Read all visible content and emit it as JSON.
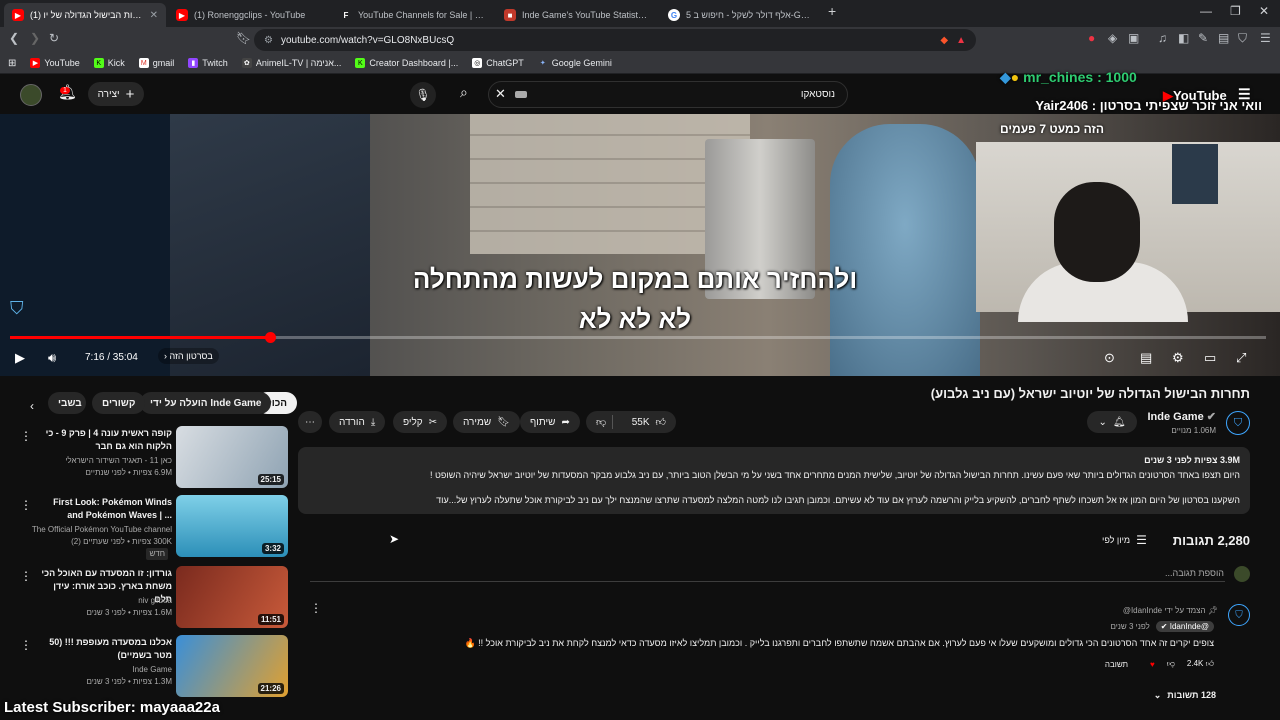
{
  "browser": {
    "tabs": [
      {
        "label": "(1) תחרות הבישול הגדולה של יו",
        "favicon": "youtube-icon",
        "active": true
      },
      {
        "label": "(1) Ronenggclips - YouTube",
        "favicon": "youtube-icon",
        "active": false
      },
      {
        "label": "YouTube Channels for Sale | Flippa",
        "favicon": "flippa-icon",
        "active": false
      },
      {
        "label": "Inde Game's YouTube Statistics - Soc",
        "favicon": "socialblade-icon",
        "active": false
      },
      {
        "label": "5 אלף דולר לשקל - חיפוש ב-Google",
        "favicon": "google-icon",
        "active": false
      }
    ],
    "url": "youtube.com/watch?v=GLO8NxBUcsQ",
    "bookmarks": [
      "YouTube",
      "Kick",
      "gmail",
      "Twitch",
      "AnimeIL-TV | אנימה...",
      "Creator Dashboard |...",
      "ChatGPT",
      "Google Gemini"
    ]
  },
  "header": {
    "create_label": "יצירה",
    "notif_count": "1",
    "search_value": "נוסטאקו"
  },
  "video": {
    "subtitle_line1": "ולהחזיר אותם במקום לעשות מהתחלה",
    "subtitle_line2": "לא לא לא",
    "time": "7:16 / 35:04",
    "chapter": "בסרטון הזה",
    "progress_fraction": 0.207,
    "overlay_top": "mr_chines : 1000",
    "overlay_yt": "YouTube",
    "overlay_line2": "וואי אני זוכר שצפיתי בסרטון : Yair2406",
    "overlay_line3": "הזה כמעט 7 פעמים",
    "overlay_bottom": "Latest Subscriber: mayaaa22a"
  },
  "info": {
    "title": "תחרות הבישול הגדולה של יוטיוב ישראל (עם ניב גלבוע)",
    "channel": "Inde Game",
    "subscribers": "1.06M מנויים",
    "likes": "55K",
    "share": "שיתוף",
    "save": "שמירה",
    "clip": "קליפ",
    "download": "הורדה",
    "desc_meta": "3.9M צפיות  לפני 3 שנים",
    "desc_line1": "היום תצפו באחד הסרטונים הגדולים ביותר שאי פעם עשינו. תחרות הבישול הגדולה של יוטיוב, שלישית המנים מתחרים אחד בשני על מי הבשלן הטוב ביותר, עם ניב גלבוע מבקר המסעדות של יוטיוב ישראל שיהיה השופט !",
    "desc_line2": "השקענו בסרטון של היום המון אז אל תשכחו לשתף לחברים, להשקיע בלייק והרשמה לערוץ אם עוד לא עשיתם. וכמובן תגיבו לנו למטה המלצה למסעדה שתרצו שהמנצח ילך עם ניב לביקורת אוכל שתעלה לערוץ של...עוד"
  },
  "chips": [
    "הכול",
    "הועלה על ידי Inde Game",
    "קשורים",
    "בשבי"
  ],
  "recommendations": [
    {
      "title": "קופה ראשית עונה 4 | פרק 9 - כי הלקוח הוא גם חבר",
      "channel": "כאן 11 - תאגיד השידור הישראלי",
      "meta": "6.9M צפיות • לפני שנתיים",
      "duration": "25:15"
    },
    {
      "title": "First Look: Pokémon Winds and Pokémon Waves | ...",
      "channel": "The Official Pokémon YouTube channel",
      "meta": "300K צפיות • לפני שעתיים (2)",
      "badge": "חדש",
      "duration": "3:32"
    },
    {
      "title": "גורדון: זו המסעדה עם האוכל הכי משחת בארץ. כוכב אורח: עידן תלם",
      "channel": "niv gilboa",
      "meta": "1.6M צפיות • לפני 3 שנים",
      "duration": "11:51"
    },
    {
      "title": "אכלנו במסעדה מעופפת !!! (50 מטר בשמיים)",
      "channel": "Inde Game",
      "meta": "1.3M צפיות • לפני 3 שנים",
      "duration": "21:26"
    }
  ],
  "comments": {
    "count": "2,280 תגובות",
    "sort": "מיון לפי",
    "add_placeholder": "הוספת תגובה...",
    "pinned_by": "הצמד על ידי IdanInde@",
    "author": "@IdanInde",
    "time": "לפני 3 שנים",
    "text": "צופים יקרים זה אחד הסרטונים הכי גדולים ומושקעים שעלו אי פעם לערוץ. אם אהבתם אשמח שתשתפו לחברים ותפרגנו בלייק . וכמובן תמליצו לאיזו מסעדה כדאי למנצח לקחת את ניב לביקורת אוכל !! 🔥",
    "likes": "2.4K",
    "reply": "תשובה",
    "replies": "128 תשובות"
  },
  "colors": {
    "accent": "#ff0000",
    "link": "#3ea6ff",
    "surface": "#272727"
  }
}
